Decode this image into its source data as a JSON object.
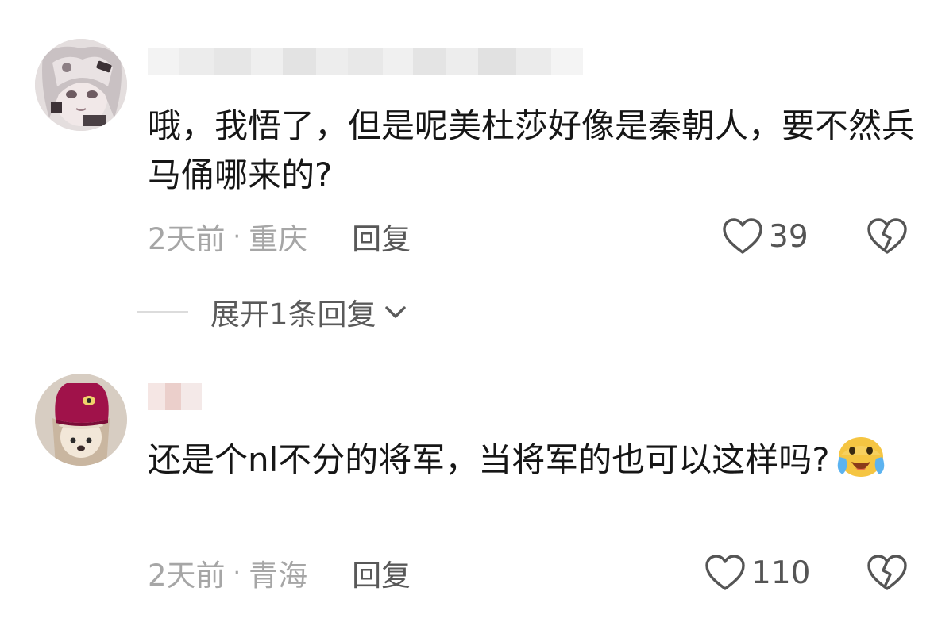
{
  "comments": [
    {
      "text": "哦，我悟了，但是呢美杜莎好像是秦朝人，要不然兵马俑哪来的?",
      "time": "2天前",
      "separator": "·",
      "location": "重庆",
      "reply_label": "回复",
      "likes": "39",
      "avatar_icon": "anime-girl-avatar",
      "expand_replies_label": "展开1条回复"
    },
    {
      "text": "还是个nl不分的将军，当将军的也可以这样吗?",
      "emoji": "crying-laughing-face-emoji",
      "time": "2天前",
      "separator": "·",
      "location": "青海",
      "reply_label": "回复",
      "likes": "110",
      "avatar_icon": "dog-with-hat-avatar"
    }
  ],
  "colors": {
    "text_primary": "#161616",
    "text_meta": "#a6a6a6",
    "text_reply": "#585858",
    "icon": "#555555"
  }
}
